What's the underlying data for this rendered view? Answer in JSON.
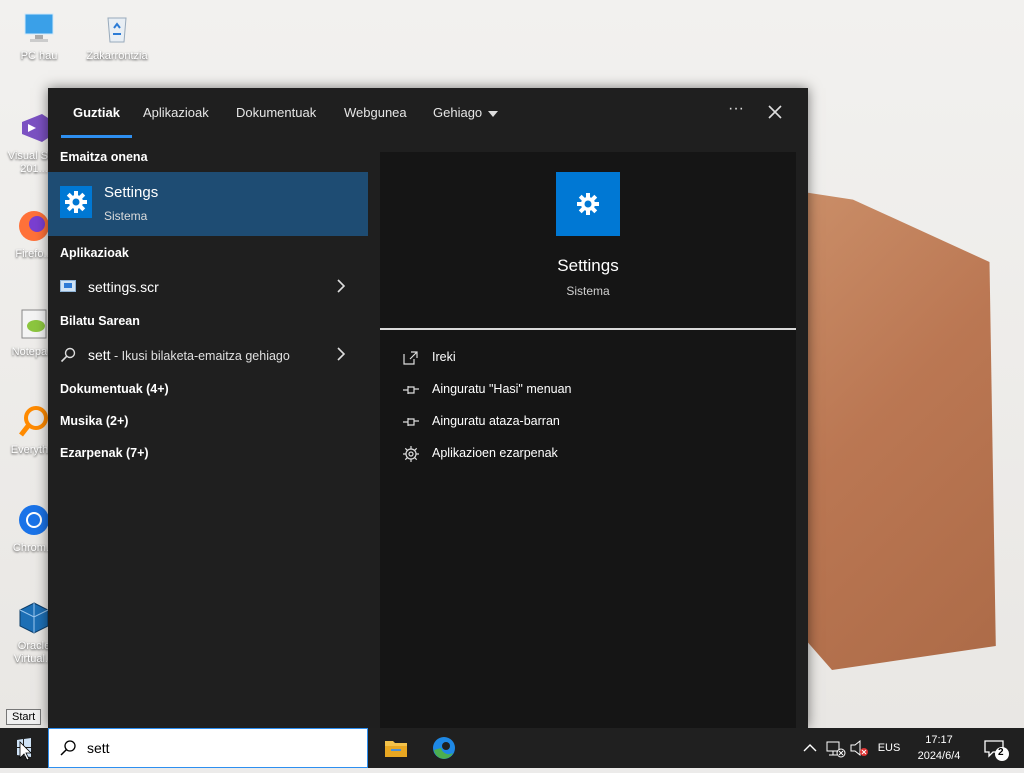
{
  "desktop": {
    "icons": [
      {
        "label": "PC hau",
        "icon": "computer-icon"
      },
      {
        "label": "Zakarrontzia",
        "icon": "recycle-bin-icon"
      },
      {
        "label": "Visual St... 201...",
        "icon": "visual-studio-icon"
      },
      {
        "label": "Firefo...",
        "icon": "firefox-icon"
      },
      {
        "label": "Notepa...",
        "icon": "notepad-plus-icon"
      },
      {
        "label": "Everyth...",
        "icon": "everything-search-icon"
      },
      {
        "label": "Chrom...",
        "icon": "chrome-icon"
      },
      {
        "label": "Oracle Virtual...",
        "icon": "virtualbox-icon"
      }
    ],
    "tooltip": "Start"
  },
  "search_flyout": {
    "tabs": [
      {
        "label": "Guztiak",
        "active": true
      },
      {
        "label": "Aplikazioak",
        "active": false
      },
      {
        "label": "Dokumentuak",
        "active": false
      },
      {
        "label": "Webgunea",
        "active": false
      },
      {
        "label": "Gehiago",
        "active": false
      }
    ],
    "more_options": "···",
    "best_match": {
      "section": "Emaitza onena",
      "title": "Settings",
      "subtitle": "Sistema"
    },
    "apps_section": "Aplikazioak",
    "app_result": "settings.scr",
    "web_section": "Bilatu Sarean",
    "web_query": "sett",
    "web_suffix": " - Ikusi bilaketa-emaitza gehiago",
    "categories": [
      "Dokumentuak (4+)",
      "Musika (2+)",
      "Ezarpenak (7+)"
    ],
    "preview": {
      "title": "Settings",
      "subtitle": "Sistema",
      "actions": [
        {
          "label": "Ireki",
          "icon": "open-icon"
        },
        {
          "label": "Ainguratu \"Hasi\" menuan",
          "icon": "pin-icon"
        },
        {
          "label": "Ainguratu ataza-barran",
          "icon": "pin-icon"
        },
        {
          "label": "Aplikazioen ezarpenak",
          "icon": "gear-icon"
        }
      ]
    }
  },
  "taskbar": {
    "search_value": "sett",
    "language": "EUS",
    "time": "17:17",
    "date": "2024/6/4",
    "notification_count": "2"
  },
  "colors": {
    "accent": "#0078d4",
    "best_match_bg": "#1e4c73",
    "flyout_bg": "#1f1f1f",
    "taskbar_bg": "#202020"
  }
}
